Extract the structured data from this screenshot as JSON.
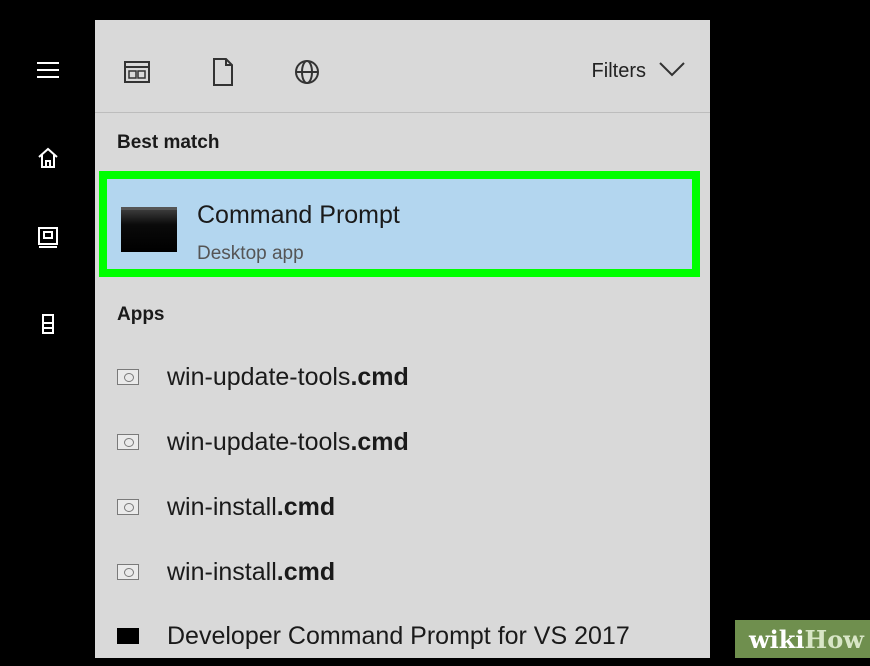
{
  "toolbar": {
    "icons": [
      "apps-icon",
      "document-icon",
      "web-icon"
    ],
    "filters_label": "Filters"
  },
  "sidebar": {
    "icons": [
      "menu-icon",
      "home-icon",
      "documents-icon",
      "tower-icon"
    ]
  },
  "best_match": {
    "section_label": "Best match",
    "title": "Command Prompt",
    "subtitle": "Desktop app"
  },
  "apps": {
    "section_label": "Apps",
    "items": [
      {
        "name": "win-update-tools",
        "ext": ".cmd",
        "icon": "script-icon"
      },
      {
        "name": "win-update-tools",
        "ext": ".cmd",
        "icon": "script-icon"
      },
      {
        "name": "win-install",
        "ext": ".cmd",
        "icon": "script-icon"
      },
      {
        "name": "win-install",
        "ext": ".cmd",
        "icon": "script-icon"
      },
      {
        "name": "Developer Command Prompt for VS 2017",
        "ext": "",
        "icon": "console-icon"
      }
    ]
  },
  "watermark": {
    "wiki": "wiki",
    "how": "How"
  },
  "colors": {
    "highlight": "#b3d6ef",
    "highlight_border": "#00ff00",
    "panel_bg": "#d9d9d9"
  }
}
